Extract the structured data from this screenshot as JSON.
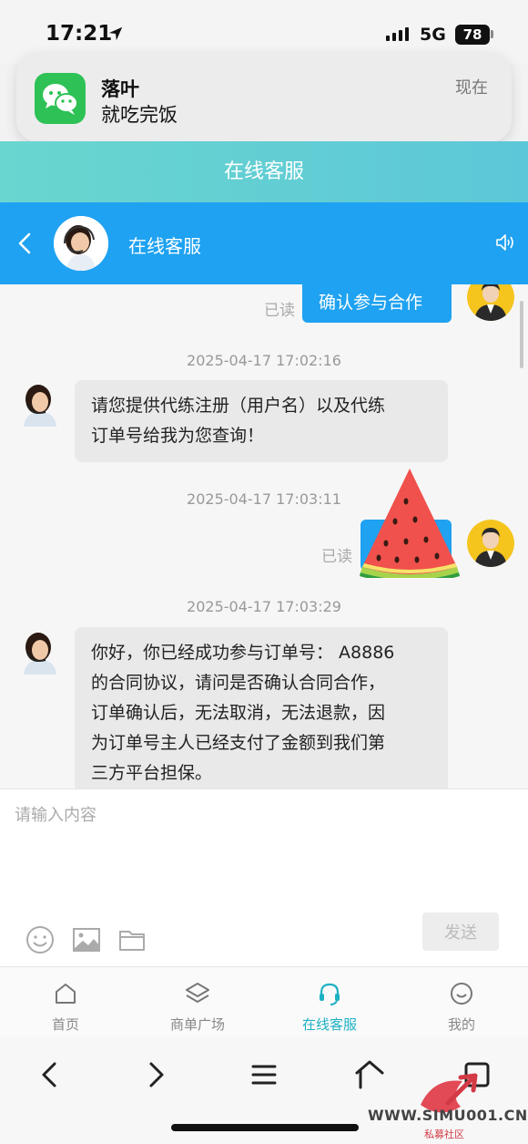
{
  "status": {
    "time": "17:21",
    "network": "5G",
    "battery": "78"
  },
  "notification": {
    "app_icon": "wechat-icon",
    "sender": "落叶",
    "message": "就吃完饭",
    "time": "现在"
  },
  "page_title": "在线客服",
  "chat_header": {
    "title": "在线客服"
  },
  "messages": {
    "read_label": "已读",
    "first_out": "确认参与合作",
    "ts1": "2025-04-17 17:02:16",
    "in1_line1": "请您提供代练注册（用户名）以及代练",
    "in1_line2": "订单号给我为您查询！",
    "ts2": "2025-04-17 17:03:11",
    "ts3": "2025-04-17 17:03:29",
    "in2_line1": "你好，你已经成功参与订单号：  A8886",
    "in2_line2": "的合同协议，请问是否确认合同合作，",
    "in2_line3": "订单确认后，无法取消，无法退款，因",
    "in2_line4": "为订单号主人已经支付了金额到我们第",
    "in2_line5": "三方平台担保。"
  },
  "input": {
    "placeholder": "请输入内容",
    "send_label": "发送"
  },
  "tabs": [
    {
      "label": "首页",
      "icon": "home-icon"
    },
    {
      "label": "商单广场",
      "icon": "layers-icon"
    },
    {
      "label": "在线客服",
      "icon": "headset-icon",
      "active": true
    },
    {
      "label": "我的",
      "icon": "smile-icon"
    }
  ],
  "watermark": {
    "text": "WWW.SIMU001.CN",
    "sub": "私募社区"
  },
  "colors": {
    "header_blue": "#1fa2f1",
    "teal": "#62cfd3",
    "active_tab": "#1fb1c4"
  }
}
